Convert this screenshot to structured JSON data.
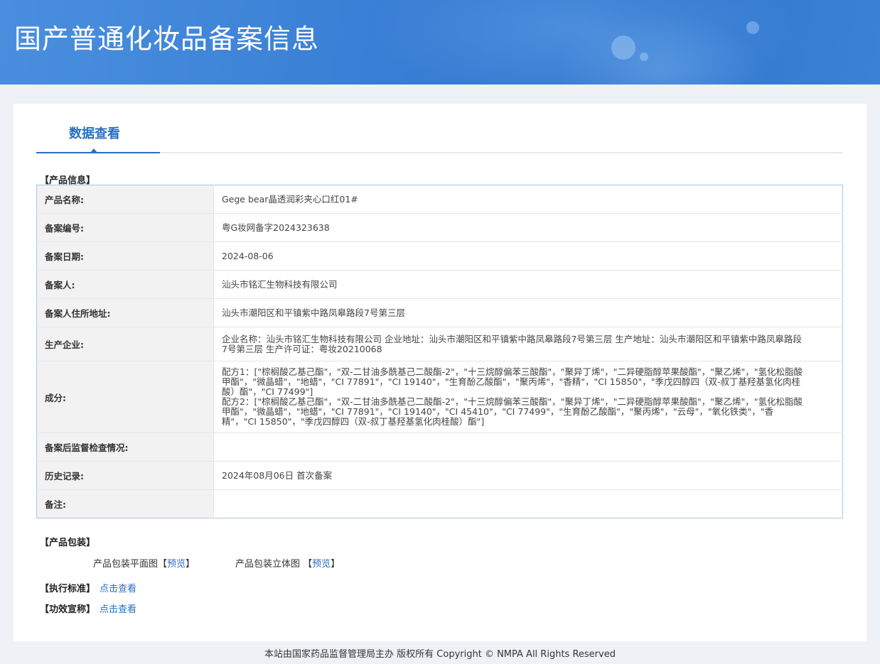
{
  "header": {
    "title": "国产普通化妆品备案信息"
  },
  "tab": {
    "label": "数据查看"
  },
  "sections": {
    "product_info": "【产品信息】",
    "packaging": "【产品包装】",
    "standard": "【执行标准】",
    "efficacy": "【功效宣称】"
  },
  "info_rows": [
    {
      "label": "产品名称:",
      "value": "Gege bear晶透润彩夹心口红01#"
    },
    {
      "label": "备案编号:",
      "value": "粤G妆网备字2024323638"
    },
    {
      "label": "备案日期:",
      "value": "2024-08-06"
    },
    {
      "label": "备案人:",
      "value": "汕头市铭汇生物科技有限公司"
    },
    {
      "label": "备案人住所地址:",
      "value": "汕头市潮阳区和平镇紫中路凤皋路段7号第三层"
    },
    {
      "label": "生产企业:",
      "value": "企业名称：汕头市铭汇生物科技有限公司 企业地址：汕头市潮阳区和平镇紫中路凤皋路段7号第三层 生产地址：汕头市潮阳区和平镇紫中路凤皋路段7号第三层 生产许可证：粤妆20210068"
    },
    {
      "label": "成分:",
      "value": "配方1：[\"棕榈酸乙基己酯\"，\"双-二甘油多酰基己二酸酯-2\"，\"十三烷醇偏苯三酸酯\"，\"聚异丁烯\"，\"二异硬脂醇苹果酸酯\"，\"聚乙烯\"，\"氢化松脂酸甲酯\"，\"微晶蜡\"，\"地蜡\"，\"CI 77891\"，\"CI 19140\"，\"生育酚乙酸酯\"，\"聚丙烯\"，\"香精\"，\"CI 15850\"，\"季戊四醇四（双-叔丁基羟基氢化肉桂酸）酯\"，\"CI 77499\"]\n配方2：[\"棕榈酸乙基己酯\"，\"双-二甘油多酰基己二酸酯-2\"，\"十三烷醇偏苯三酸酯\"，\"聚异丁烯\"，\"二异硬脂醇苹果酸酯\"，\"聚乙烯\"，\"氢化松脂酸甲酯\"，\"微晶蜡\"，\"地蜡\"，\"CI 77891\"，\"CI 19140\"，\"CI 45410\"，\"CI 77499\"，\"生育酚乙酸酯\"，\"聚丙烯\"，\"云母\"，\"氧化铁类\"，\"香精\"，\"CI 15850\"，\"季戊四醇四（双-叔丁基羟基氢化肉桂酸）酯\"]"
    },
    {
      "label": "备案后监督检查情况:",
      "value": ""
    },
    {
      "label": "历史记录:",
      "value": "2024年08月06日 首次备案"
    },
    {
      "label": "备注:",
      "value": ""
    }
  ],
  "packaging": {
    "flat_label": "产品包装平面图",
    "flat_preview": "预览",
    "solid_label": "产品包装立体图",
    "solid_preview": "预览",
    "bracket_open": "【",
    "bracket_close": "】"
  },
  "links": {
    "standard_view": "点击查看",
    "efficacy_view": "点击查看"
  },
  "footer": {
    "text": "本站由国家药品监督管理局主办 版权所有 Copyright © NMPA All Rights Reserved"
  }
}
